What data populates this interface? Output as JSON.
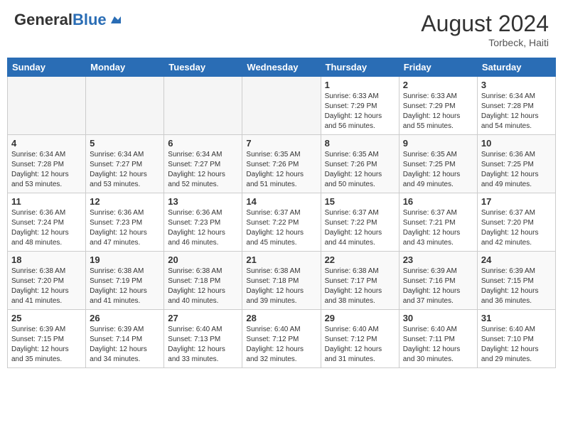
{
  "header": {
    "logo_general": "General",
    "logo_blue": "Blue",
    "month_year": "August 2024",
    "location": "Torbeck, Haiti"
  },
  "days_of_week": [
    "Sunday",
    "Monday",
    "Tuesday",
    "Wednesday",
    "Thursday",
    "Friday",
    "Saturday"
  ],
  "weeks": [
    [
      {
        "day": "",
        "empty": true
      },
      {
        "day": "",
        "empty": true
      },
      {
        "day": "",
        "empty": true
      },
      {
        "day": "",
        "empty": true
      },
      {
        "day": "1",
        "sunrise": "Sunrise: 6:33 AM",
        "sunset": "Sunset: 7:29 PM",
        "daylight": "Daylight: 12 hours and 56 minutes."
      },
      {
        "day": "2",
        "sunrise": "Sunrise: 6:33 AM",
        "sunset": "Sunset: 7:29 PM",
        "daylight": "Daylight: 12 hours and 55 minutes."
      },
      {
        "day": "3",
        "sunrise": "Sunrise: 6:34 AM",
        "sunset": "Sunset: 7:28 PM",
        "daylight": "Daylight: 12 hours and 54 minutes."
      }
    ],
    [
      {
        "day": "4",
        "sunrise": "Sunrise: 6:34 AM",
        "sunset": "Sunset: 7:28 PM",
        "daylight": "Daylight: 12 hours and 53 minutes."
      },
      {
        "day": "5",
        "sunrise": "Sunrise: 6:34 AM",
        "sunset": "Sunset: 7:27 PM",
        "daylight": "Daylight: 12 hours and 53 minutes."
      },
      {
        "day": "6",
        "sunrise": "Sunrise: 6:34 AM",
        "sunset": "Sunset: 7:27 PM",
        "daylight": "Daylight: 12 hours and 52 minutes."
      },
      {
        "day": "7",
        "sunrise": "Sunrise: 6:35 AM",
        "sunset": "Sunset: 7:26 PM",
        "daylight": "Daylight: 12 hours and 51 minutes."
      },
      {
        "day": "8",
        "sunrise": "Sunrise: 6:35 AM",
        "sunset": "Sunset: 7:26 PM",
        "daylight": "Daylight: 12 hours and 50 minutes."
      },
      {
        "day": "9",
        "sunrise": "Sunrise: 6:35 AM",
        "sunset": "Sunset: 7:25 PM",
        "daylight": "Daylight: 12 hours and 49 minutes."
      },
      {
        "day": "10",
        "sunrise": "Sunrise: 6:36 AM",
        "sunset": "Sunset: 7:25 PM",
        "daylight": "Daylight: 12 hours and 49 minutes."
      }
    ],
    [
      {
        "day": "11",
        "sunrise": "Sunrise: 6:36 AM",
        "sunset": "Sunset: 7:24 PM",
        "daylight": "Daylight: 12 hours and 48 minutes."
      },
      {
        "day": "12",
        "sunrise": "Sunrise: 6:36 AM",
        "sunset": "Sunset: 7:23 PM",
        "daylight": "Daylight: 12 hours and 47 minutes."
      },
      {
        "day": "13",
        "sunrise": "Sunrise: 6:36 AM",
        "sunset": "Sunset: 7:23 PM",
        "daylight": "Daylight: 12 hours and 46 minutes."
      },
      {
        "day": "14",
        "sunrise": "Sunrise: 6:37 AM",
        "sunset": "Sunset: 7:22 PM",
        "daylight": "Daylight: 12 hours and 45 minutes."
      },
      {
        "day": "15",
        "sunrise": "Sunrise: 6:37 AM",
        "sunset": "Sunset: 7:22 PM",
        "daylight": "Daylight: 12 hours and 44 minutes."
      },
      {
        "day": "16",
        "sunrise": "Sunrise: 6:37 AM",
        "sunset": "Sunset: 7:21 PM",
        "daylight": "Daylight: 12 hours and 43 minutes."
      },
      {
        "day": "17",
        "sunrise": "Sunrise: 6:37 AM",
        "sunset": "Sunset: 7:20 PM",
        "daylight": "Daylight: 12 hours and 42 minutes."
      }
    ],
    [
      {
        "day": "18",
        "sunrise": "Sunrise: 6:38 AM",
        "sunset": "Sunset: 7:20 PM",
        "daylight": "Daylight: 12 hours and 41 minutes."
      },
      {
        "day": "19",
        "sunrise": "Sunrise: 6:38 AM",
        "sunset": "Sunset: 7:19 PM",
        "daylight": "Daylight: 12 hours and 41 minutes."
      },
      {
        "day": "20",
        "sunrise": "Sunrise: 6:38 AM",
        "sunset": "Sunset: 7:18 PM",
        "daylight": "Daylight: 12 hours and 40 minutes."
      },
      {
        "day": "21",
        "sunrise": "Sunrise: 6:38 AM",
        "sunset": "Sunset: 7:18 PM",
        "daylight": "Daylight: 12 hours and 39 minutes."
      },
      {
        "day": "22",
        "sunrise": "Sunrise: 6:38 AM",
        "sunset": "Sunset: 7:17 PM",
        "daylight": "Daylight: 12 hours and 38 minutes."
      },
      {
        "day": "23",
        "sunrise": "Sunrise: 6:39 AM",
        "sunset": "Sunset: 7:16 PM",
        "daylight": "Daylight: 12 hours and 37 minutes."
      },
      {
        "day": "24",
        "sunrise": "Sunrise: 6:39 AM",
        "sunset": "Sunset: 7:15 PM",
        "daylight": "Daylight: 12 hours and 36 minutes."
      }
    ],
    [
      {
        "day": "25",
        "sunrise": "Sunrise: 6:39 AM",
        "sunset": "Sunset: 7:15 PM",
        "daylight": "Daylight: 12 hours and 35 minutes."
      },
      {
        "day": "26",
        "sunrise": "Sunrise: 6:39 AM",
        "sunset": "Sunset: 7:14 PM",
        "daylight": "Daylight: 12 hours and 34 minutes."
      },
      {
        "day": "27",
        "sunrise": "Sunrise: 6:40 AM",
        "sunset": "Sunset: 7:13 PM",
        "daylight": "Daylight: 12 hours and 33 minutes."
      },
      {
        "day": "28",
        "sunrise": "Sunrise: 6:40 AM",
        "sunset": "Sunset: 7:12 PM",
        "daylight": "Daylight: 12 hours and 32 minutes."
      },
      {
        "day": "29",
        "sunrise": "Sunrise: 6:40 AM",
        "sunset": "Sunset: 7:12 PM",
        "daylight": "Daylight: 12 hours and 31 minutes."
      },
      {
        "day": "30",
        "sunrise": "Sunrise: 6:40 AM",
        "sunset": "Sunset: 7:11 PM",
        "daylight": "Daylight: 12 hours and 30 minutes."
      },
      {
        "day": "31",
        "sunrise": "Sunrise: 6:40 AM",
        "sunset": "Sunset: 7:10 PM",
        "daylight": "Daylight: 12 hours and 29 minutes."
      }
    ]
  ]
}
